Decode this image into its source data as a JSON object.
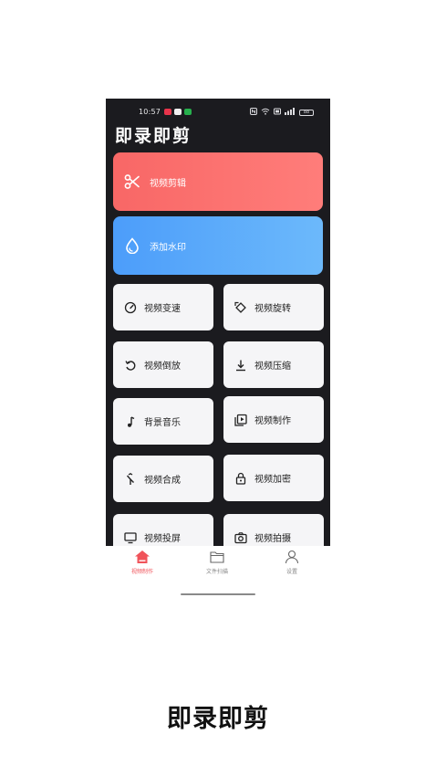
{
  "status": {
    "time": "10:57",
    "right_icons": [
      "nfc-icon",
      "wifi-icon",
      "sim-icon",
      "signal-icon"
    ],
    "battery": "88"
  },
  "app": {
    "title": "即录即剪"
  },
  "features": [
    {
      "label": "视频剪辑",
      "icon": "scissors-icon",
      "color": "#f86766"
    },
    {
      "label": "添加水印",
      "icon": "droplet-icon",
      "color": "#4c9dfa"
    }
  ],
  "tools": [
    {
      "label": "视频变速",
      "icon": "speedometer-icon"
    },
    {
      "label": "视频旋转",
      "icon": "rotate-icon"
    },
    {
      "label": "视频倒放",
      "icon": "undo-icon"
    },
    {
      "label": "视频压缩",
      "icon": "download-icon"
    },
    {
      "label": "背景音乐",
      "icon": "music-note-icon"
    },
    {
      "label": "视频制作",
      "icon": "video-library-icon"
    },
    {
      "label": "视频合成",
      "icon": "merge-icon"
    },
    {
      "label": "视频加密",
      "icon": "lock-icon"
    },
    {
      "label": "视频投屏",
      "icon": "monitor-icon"
    },
    {
      "label": "视频拍摄",
      "icon": "camera-icon"
    }
  ],
  "tabs": [
    {
      "label": "视频制作",
      "icon": "home-icon",
      "active": true
    },
    {
      "label": "文件扫描",
      "icon": "folder-icon",
      "active": false
    },
    {
      "label": "设置",
      "icon": "user-icon",
      "active": false
    }
  ],
  "caption": "即录即剪",
  "colors": {
    "accent": "#f0535a",
    "background": "#1b1b1f",
    "card": "#f5f5f7"
  }
}
